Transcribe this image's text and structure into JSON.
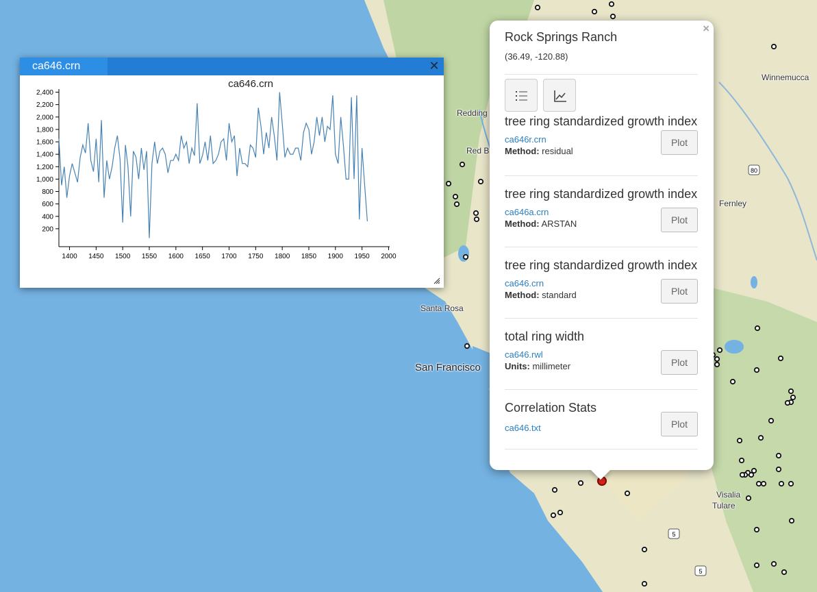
{
  "map": {
    "labels": [
      "Redding",
      "Red B",
      "Winnemucca",
      "Fernley",
      "Santa Rosa",
      "San Francisco",
      "Visalia",
      "Tulare"
    ],
    "highway_shields": [
      "80",
      "5",
      "5"
    ],
    "colors": {
      "water": "#74b2e2",
      "land": "#e8e5c9",
      "forest": "#b7d39e",
      "marker": "#e0241b"
    }
  },
  "chart_dialog": {
    "tab_title": "ca646.crn",
    "close_label": "✕",
    "chart_title": "ca646.crn"
  },
  "chart_data": {
    "type": "line",
    "title": "ca646.crn",
    "xlabel": "",
    "ylabel": "",
    "xlim": [
      1380,
      2002
    ],
    "ylim": [
      0,
      2450
    ],
    "x_ticks": [
      1400,
      1450,
      1500,
      1550,
      1600,
      1650,
      1700,
      1750,
      1800,
      1850,
      1900,
      1950,
      2000
    ],
    "y_ticks": [
      200,
      400,
      600,
      800,
      1000,
      1200,
      1400,
      1600,
      1800,
      2000,
      2200,
      2400
    ],
    "y_tick_labels": [
      "200",
      "400",
      "600",
      "800",
      "1,000",
      "1,200",
      "1,400",
      "1,600",
      "1,800",
      "2,000",
      "2,200",
      "2,400"
    ],
    "x_tick_labels": [
      "1400",
      "1450",
      "1500",
      "1550",
      "1600",
      "1650",
      "1700",
      "1750",
      "1800",
      "1850",
      "1900",
      "1950",
      "2000"
    ],
    "series": [
      {
        "color": "#4682b4",
        "x_start": 1380,
        "x_step": 5,
        "values": [
          1650,
          900,
          1200,
          700,
          1050,
          1250,
          1100,
          950,
          1350,
          1550,
          1420,
          1900,
          1300,
          1120,
          1650,
          950,
          1950,
          700,
          1300,
          1000,
          1200,
          1500,
          1700,
          1320,
          300,
          1550,
          1200,
          400,
          1450,
          1350,
          1000,
          1500,
          1150,
          1450,
          50,
          1250,
          1600,
          1250,
          1450,
          1500,
          1400,
          1100,
          1300,
          1300,
          1400,
          1300,
          1700,
          1500,
          1600,
          1250,
          1500,
          1380,
          2220,
          1250,
          1380,
          1600,
          1300,
          1700,
          1250,
          1300,
          1400,
          1600,
          1650,
          1300,
          1900,
          1600,
          1700,
          1050,
          1500,
          1250,
          1250,
          1200,
          1550,
          1500,
          1350,
          2150,
          1850,
          1400,
          1750,
          1500,
          2000,
          1700,
          1300,
          2400,
          1900,
          1350,
          1500,
          1400,
          1400,
          1500,
          1500,
          1300,
          1750,
          1900,
          1800,
          1400,
          1600,
          2000,
          1700,
          2000,
          1600,
          1850,
          1800,
          2350,
          1400,
          1250,
          2000,
          1550,
          1000,
          1000,
          2320,
          1000,
          2350,
          350,
          1500,
          900,
          320
        ]
      }
    ]
  },
  "popup": {
    "site_name": "Rock Springs Ranch",
    "coords": "(36.49, -120.88)",
    "close_label": "×",
    "datasets": [
      {
        "title": "tree ring standardized growth index",
        "file": "ca646r.crn",
        "meta_label": "Method:",
        "meta_value": "residual",
        "button": "Plot"
      },
      {
        "title": "tree ring standardized growth index",
        "file": "ca646a.crn",
        "meta_label": "Method:",
        "meta_value": "ARSTAN",
        "button": "Plot"
      },
      {
        "title": "tree ring standardized growth index",
        "file": "ca646.crn",
        "meta_label": "Method:",
        "meta_value": "standard",
        "button": "Plot"
      },
      {
        "title": "total ring width",
        "file": "ca646.rwl",
        "meta_label": "Units:",
        "meta_value": "millimeter",
        "button": "Plot"
      },
      {
        "title": "Correlation Stats",
        "file": "ca646.txt",
        "button": "Plot"
      }
    ],
    "tools": [
      "list-icon",
      "line-chart-icon"
    ]
  }
}
